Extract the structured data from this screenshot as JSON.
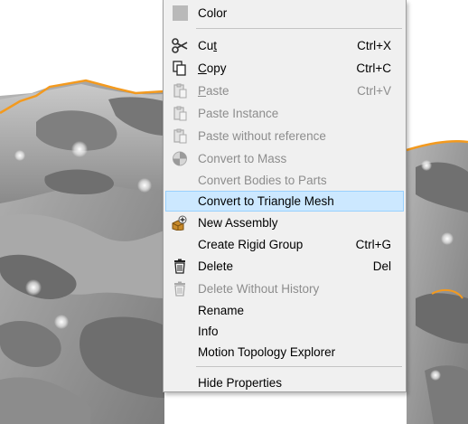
{
  "viewport": {
    "description_colors": {
      "model_gray": "#9a9a9a",
      "highlight_edge": "#f39a1f"
    }
  },
  "context_menu": {
    "items": [
      {
        "label": "Color",
        "icon": "color-swatch-icon",
        "enabled": true
      },
      {
        "label_pre": "Cu",
        "mnemonic": "t",
        "label_post": "",
        "shortcut": "Ctrl+X",
        "icon": "scissors-icon",
        "enabled": true
      },
      {
        "label_pre": "",
        "mnemonic": "C",
        "label_post": "opy",
        "shortcut": "Ctrl+C",
        "icon": "copy-icon",
        "enabled": true
      },
      {
        "label_pre": "",
        "mnemonic": "P",
        "label_post": "aste",
        "shortcut": "Ctrl+V",
        "icon": "clipboard-icon",
        "enabled": false
      },
      {
        "label": "Paste Instance",
        "icon": "clipboard-icon",
        "enabled": false
      },
      {
        "label": "Paste without reference",
        "icon": "clipboard-icon",
        "enabled": false
      },
      {
        "label": "Convert to Mass",
        "icon": "mass-icon",
        "enabled": false
      },
      {
        "label": "Convert Bodies to Parts",
        "enabled": false
      },
      {
        "label": "Convert to Triangle Mesh",
        "enabled": true,
        "highlighted": true
      },
      {
        "label": "New Assembly",
        "icon": "new-assembly-icon",
        "enabled": true
      },
      {
        "label": "Create Rigid Group",
        "shortcut": "Ctrl+G",
        "enabled": true
      },
      {
        "label": "Delete",
        "shortcut": "Del",
        "icon": "trash-icon",
        "enabled": true
      },
      {
        "label": "Delete Without History",
        "icon": "trash-icon",
        "enabled": false
      },
      {
        "label": "Rename",
        "enabled": true
      },
      {
        "label": "Info",
        "enabled": true
      },
      {
        "label": "Motion Topology Explorer",
        "enabled": true
      },
      {
        "label": "Hide Properties",
        "enabled": true
      }
    ]
  }
}
